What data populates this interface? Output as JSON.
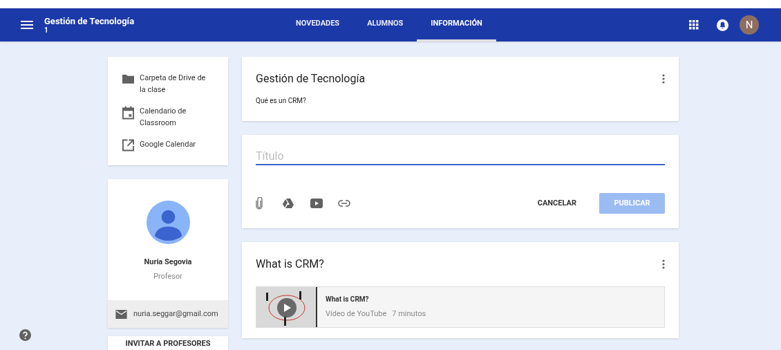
{
  "header": {
    "course_title": "Gestión de Tecnología",
    "section": "1",
    "avatar_letter": "N"
  },
  "tabs": [
    {
      "label": "NOVEDADES",
      "selected": false
    },
    {
      "label": "ALUMNOS",
      "selected": false
    },
    {
      "label": "INFORMACIÓN",
      "selected": true
    }
  ],
  "links": [
    {
      "kind": "folder",
      "label": "Carpeta de Drive de la clase"
    },
    {
      "kind": "calendar",
      "label": "Calendario de Classroom"
    },
    {
      "kind": "external",
      "label": "Google Calendar"
    }
  ],
  "teacher": {
    "name": "Nuria Segovia",
    "role": "Profesor",
    "email": "nuria.seggar@gmail.com"
  },
  "invite_button": "INVITAR A PROFESORES",
  "about": {
    "title": "Gestión de Tecnología",
    "description": "Qué es un CRM?"
  },
  "composer": {
    "placeholder": "Título",
    "cancel": "CANCELAR",
    "publish": "PUBLICAR",
    "publish_disabled": true
  },
  "post": {
    "title": "What is CRM?",
    "attachment": {
      "title": "What is CRM?",
      "source": "Vídeo de YouTube",
      "duration": "7 minutos"
    }
  }
}
